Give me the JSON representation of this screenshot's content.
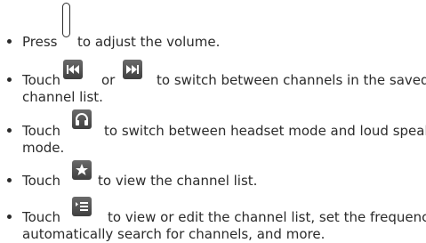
{
  "instructions": [
    {
      "before_icon": "Press",
      "icon": "volume-key-icon",
      "after_icon": "to adjust the volume."
    },
    {
      "before_icon": "Touch",
      "icon_1": "previous-channel-icon",
      "between_icons": "or",
      "icon_2": "next-channel-icon",
      "after_icon": "to switch between channels in the saved",
      "continuation": "channel list."
    },
    {
      "before_icon": "Touch",
      "icon": "headset-icon",
      "after_icon": "to switch between headset mode and loud speaker",
      "continuation": "mode."
    },
    {
      "before_icon": "Touch",
      "icon": "star-icon",
      "after_icon": "to view the channel list."
    },
    {
      "before_icon": "Touch",
      "icon": "menu-list-icon",
      "after_icon": "to view or edit the channel list, set the frequency,",
      "continuation": "automatically search for channels, and more."
    }
  ],
  "colors": {
    "text": "#2b2b2b",
    "icon_bg": "#4a4a4a",
    "icon_fg": "#ffffff"
  }
}
